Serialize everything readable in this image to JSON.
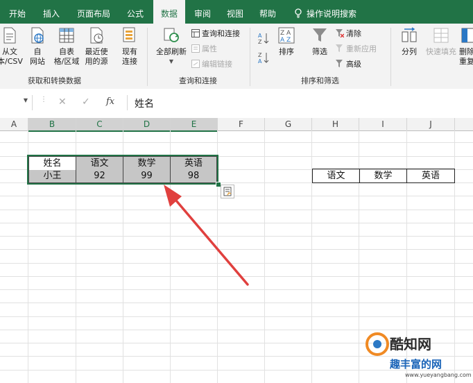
{
  "tabs": [
    {
      "label": "开始",
      "active": false
    },
    {
      "label": "插入",
      "active": false
    },
    {
      "label": "页面布局",
      "active": false
    },
    {
      "label": "公式",
      "active": false
    },
    {
      "label": "数据",
      "active": true
    },
    {
      "label": "审阅",
      "active": false
    },
    {
      "label": "视图",
      "active": false
    },
    {
      "label": "帮助",
      "active": false
    }
  ],
  "tell_me": "操作说明搜索",
  "ribbon": {
    "get_transform": {
      "label": "获取和转换数据",
      "from_text": [
        "从文",
        "本/CSV"
      ],
      "from_web": [
        "自",
        "网站"
      ],
      "from_table": [
        "自表",
        "格/区域"
      ],
      "recent_sources": [
        "最近使",
        "用的源"
      ],
      "existing": [
        "现有",
        "连接"
      ]
    },
    "queries": {
      "label": "查询和连接",
      "refresh_all": "全部刷新",
      "queries_connections": "查询和连接",
      "properties": "属性",
      "edit_links": "编辑链接"
    },
    "sort_filter": {
      "label": "排序和筛选",
      "sort": "排序",
      "filter": "筛选",
      "clear": "清除",
      "reapply": "重新应用",
      "advanced": "高级"
    },
    "tools": {
      "split": "分列",
      "flash_fill": "快速填充",
      "remove_dup": [
        "删除",
        "重复"
      ]
    }
  },
  "formula_bar": {
    "fx": "fx",
    "content": "姓名"
  },
  "columns": [
    "A",
    "B",
    "C",
    "D",
    "E",
    "F",
    "G",
    "H",
    "I",
    "J"
  ],
  "table1": {
    "headers": [
      "姓名",
      "语文",
      "数学",
      "英语"
    ],
    "row": [
      "小王",
      "92",
      "99",
      "98"
    ]
  },
  "table2": {
    "headers": [
      "语文",
      "数学",
      "英语"
    ]
  },
  "watermark": {
    "line1": "酷知网",
    "line2": "趣丰富的网",
    "url": "www.yueyangbang.com"
  },
  "colors": {
    "excel_green": "#217346",
    "arrow_red": "#e0403e"
  }
}
